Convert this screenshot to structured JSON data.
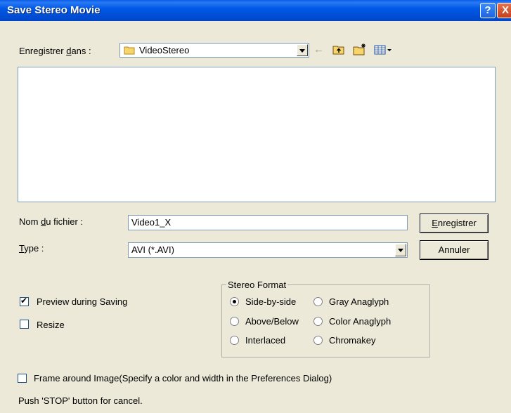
{
  "window": {
    "title": "Save Stereo Movie",
    "help_icon": "?",
    "close_icon": "X"
  },
  "location": {
    "label_prefix": "Enregistrer ",
    "label_accel": "d",
    "label_suffix": "ans :",
    "value": "VideoStereo"
  },
  "toolbar": {
    "back": "←",
    "up_folder": "⮤",
    "new_folder": "✱",
    "view_menu": "▦▾"
  },
  "file_name": {
    "label_prefix": "Nom ",
    "label_accel": "d",
    "label_suffix": "u fichier :",
    "value": "Video1_X"
  },
  "file_type": {
    "label_accel": "T",
    "label_suffix": "ype :",
    "value": "AVI (*.AVI)"
  },
  "buttons": {
    "save_accel": "E",
    "save_rest": "nregistrer",
    "cancel": "Annuler"
  },
  "options": {
    "preview": {
      "label": "Preview during Saving",
      "checked": true
    },
    "resize": {
      "label": "Resize",
      "checked": false
    },
    "frame": {
      "label": "Frame around Image(Specify a color and width in the Preferences Dialog)",
      "checked": false
    }
  },
  "stereo_format": {
    "title": "Stereo Format",
    "side_by_side": "Side-by-side",
    "above_below": "Above/Below",
    "interlaced": "Interlaced",
    "gray_anaglyph": "Gray Anaglyph",
    "color_anaglyph": "Color Anaglyph",
    "chromakey": "Chromakey",
    "selected": "Side-by-side"
  },
  "status_text": "Push 'STOP' button for cancel."
}
